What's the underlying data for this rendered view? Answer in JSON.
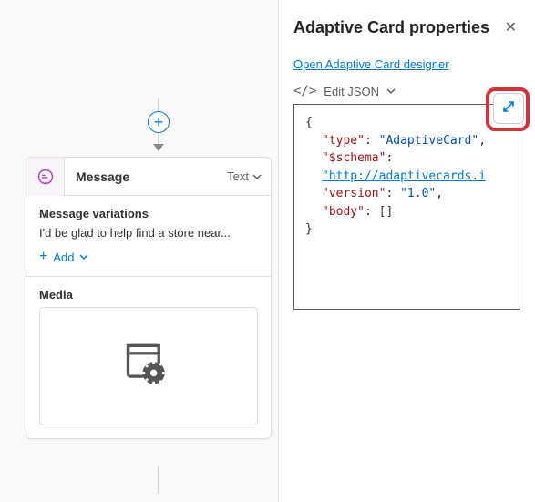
{
  "canvas": {
    "add_node_icon": "+",
    "message_card": {
      "title": "Message",
      "type_label": "Text",
      "variations_label": "Message variations",
      "variation_text": "I'd be glad to help find a store near...",
      "add_label": "Add",
      "media_label": "Media"
    }
  },
  "panel": {
    "title": "Adaptive Card properties",
    "designer_link": "Open Adaptive Card designer",
    "edit_json_label": "Edit JSON",
    "json": {
      "l1": "{",
      "l2k": "\"type\"",
      "l2v": "\"AdaptiveCard\"",
      "l3k": "\"$schema\"",
      "l3v": "\"http://adaptivecards.i",
      "l4k": "\"version\"",
      "l4v": "\"1.0\"",
      "l5k": "\"body\"",
      "l5v": "[]",
      "l6": "}"
    }
  }
}
